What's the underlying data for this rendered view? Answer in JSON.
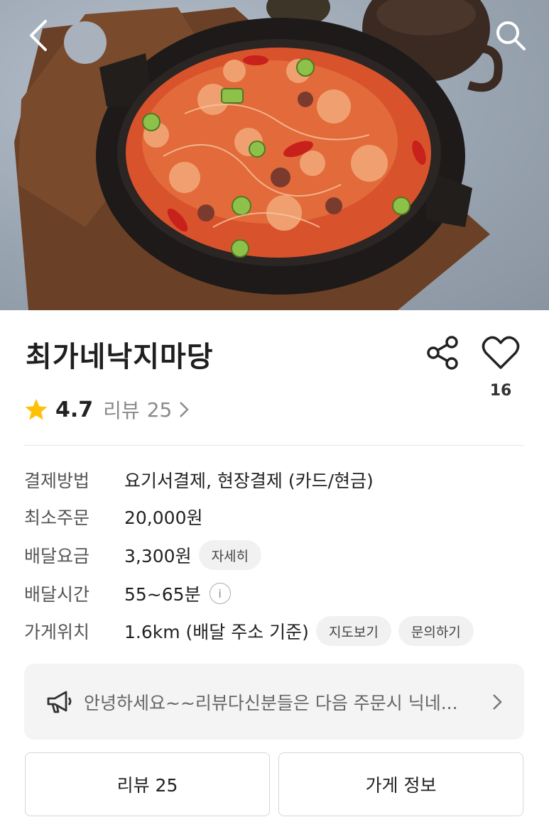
{
  "header": {
    "back_icon": "chevron-left-icon",
    "search_icon": "search-icon"
  },
  "store": {
    "name": "최가네낙지마당",
    "rating": "4.7",
    "review_label": "리뷰",
    "review_count": "25",
    "like_count": "16",
    "star_color": "#FFC107"
  },
  "info": {
    "payment_label": "결제방법",
    "payment_value": "요기서결제, 현장결제 (카드/현금)",
    "min_order_label": "최소주문",
    "min_order_value": "20,000원",
    "delivery_fee_label": "배달요금",
    "delivery_fee_value": "3,300원",
    "delivery_fee_detail": "자세히",
    "delivery_time_label": "배달시간",
    "delivery_time_value": "55~65분",
    "info_icon_glyph": "i",
    "location_label": "가게위치",
    "location_value": "1.6km (배달 주소 기준)",
    "map_button": "지도보기",
    "inquiry_button": "문의하기"
  },
  "notice": {
    "icon": "megaphone-icon",
    "text": "안녕하세요~~리뷰다신분들은 다음 주문시 닉네..."
  },
  "tabs": [
    {
      "label": "리뷰 25"
    },
    {
      "label": "가게 정보"
    }
  ]
}
